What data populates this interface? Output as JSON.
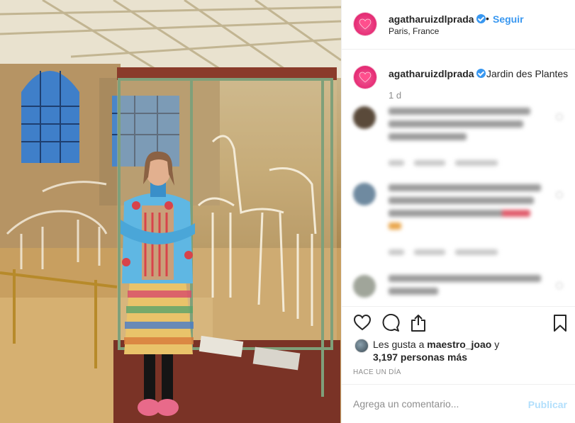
{
  "header": {
    "username": "agatharuizdlprada",
    "separator": "•",
    "follow_label": "Seguir",
    "location": "Paris, France",
    "more": "···"
  },
  "caption": {
    "username": "agatharuizdlprada",
    "text": "Jardin des Plantes",
    "age": "1 d"
  },
  "likes": {
    "prefix": "Les gusta a",
    "user": "maestro_joao",
    "suffix": "y",
    "count": "3,197 personas más"
  },
  "timestamp": "HACE UN DÍA",
  "comment_box": {
    "placeholder": "Agrega un comentario...",
    "publish_label": "Publicar"
  },
  "colors": {
    "accent": "#3897f0",
    "publish_disabled": "#b2dffc",
    "avatar": "#e8337a"
  },
  "icons": [
    "heart-icon",
    "comment-icon",
    "share-icon",
    "bookmark-icon",
    "verified-icon"
  ]
}
